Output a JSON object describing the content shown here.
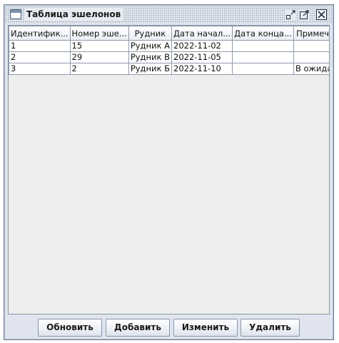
{
  "window": {
    "title": "Таблица эшелонов"
  },
  "table": {
    "columns": [
      "Идентифик...",
      "Номер эше...",
      "Рудник",
      "Дата начал...",
      "Дата конца...",
      "Примечание"
    ],
    "rows": [
      [
        "1",
        "15",
        "Рудник А",
        "2022-11-02",
        "",
        ""
      ],
      [
        "2",
        "29",
        "Рудник В",
        "2022-11-05",
        "",
        ""
      ],
      [
        "3",
        "2",
        "Рудник Б",
        "2022-11-10",
        "",
        "В ожидани..."
      ]
    ]
  },
  "buttons": {
    "refresh": "Обновить",
    "add": "Добавить",
    "edit": "Изменить",
    "delete": "Удалить"
  }
}
